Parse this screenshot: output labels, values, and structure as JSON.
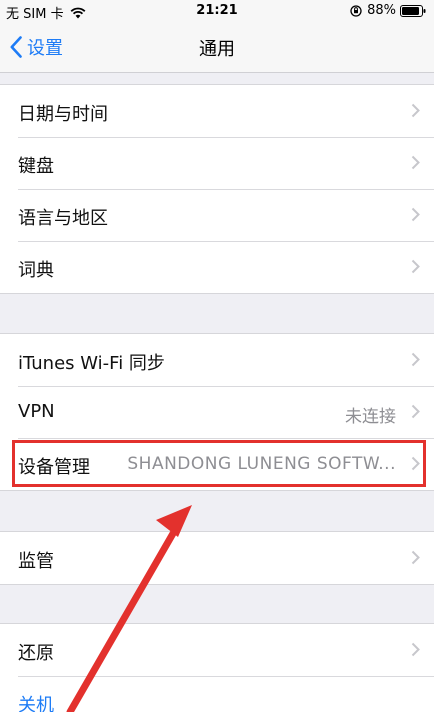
{
  "status_bar": {
    "carrier": "无 SIM 卡",
    "time": "21:21",
    "battery": "88%"
  },
  "nav": {
    "back_label": "设置",
    "title": "通用"
  },
  "group1": {
    "items": [
      {
        "label": "日期与时间"
      },
      {
        "label": "键盘"
      },
      {
        "label": "语言与地区"
      },
      {
        "label": "词典"
      }
    ]
  },
  "group2": {
    "items": [
      {
        "label": "iTunes Wi-Fi 同步",
        "value": ""
      },
      {
        "label": "VPN",
        "value": "未连接"
      },
      {
        "label": "设备管理",
        "value": "SHANDONG LUNENG SOFTW..."
      }
    ]
  },
  "group3": {
    "items": [
      {
        "label": "监管"
      }
    ]
  },
  "group4": {
    "items": [
      {
        "label": "还原"
      },
      {
        "label": "关机"
      }
    ]
  },
  "colors": {
    "accent": "#1e7cf6",
    "annotation": "#e3312d",
    "background": "#efeff4"
  },
  "icons": [
    "wifi-icon",
    "lock-rotation-icon",
    "battery-icon",
    "back-chevron-icon",
    "chevron-right-icon",
    "arrow-annotation"
  ]
}
